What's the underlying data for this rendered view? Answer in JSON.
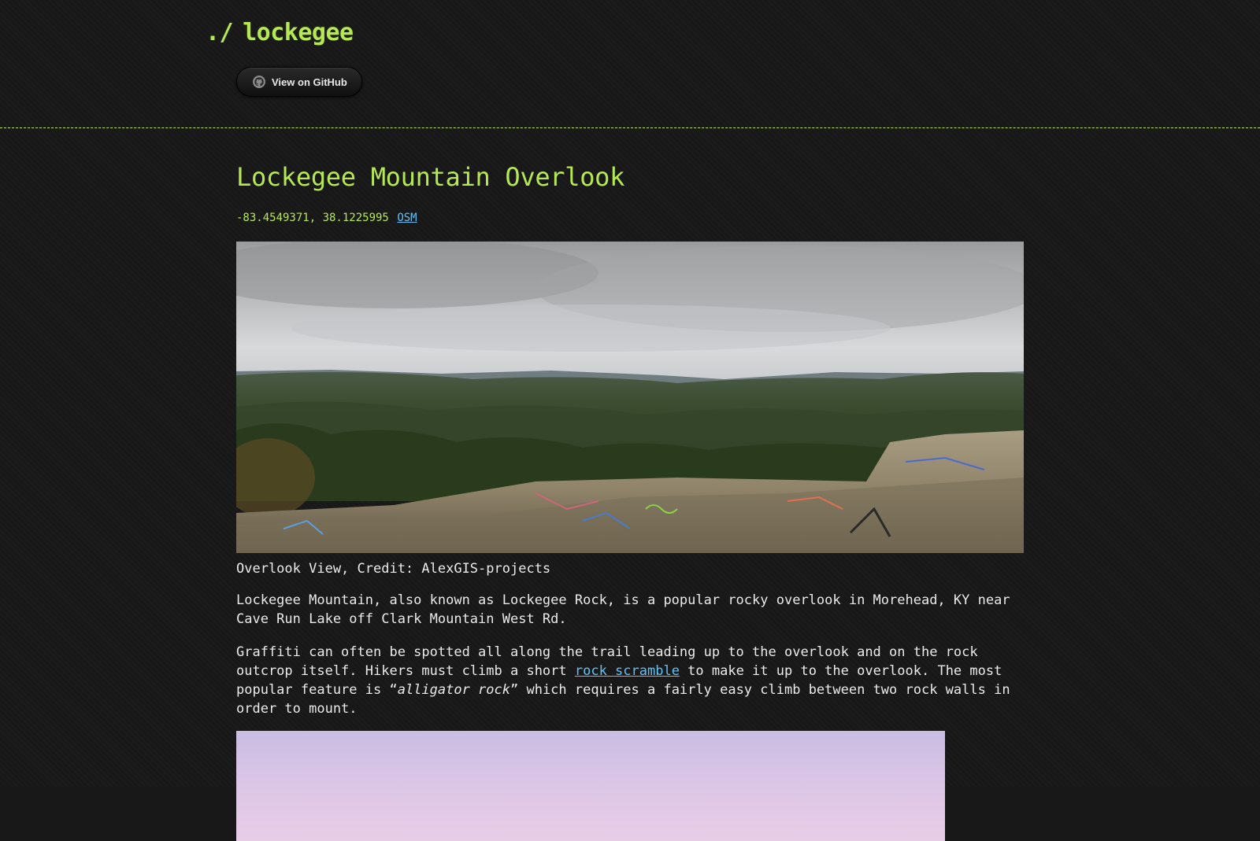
{
  "header": {
    "prompt": "./",
    "site_name": "lockegee",
    "github_button": "View on GitHub",
    "accent_color": "#b5e853"
  },
  "page": {
    "title": "Lockegee Mountain Overlook",
    "coordinates": "-83.4549371, 38.1225995",
    "osm_link": "OSM",
    "image_caption": "Overlook View, Credit: AlexGIS-projects",
    "paragraph1": "Lockegee Mountain, also known as Lockegee Rock, is a popular rocky overlook in Morehead, KY near Cave Run Lake off Clark Mountain West Rd.",
    "paragraph2_part1": "Graffiti can often be spotted all along the trail leading up to the overlook and on the rock outcrop itself. Hikers must climb a short ",
    "paragraph2_link": "rock scramble",
    "paragraph2_part2": " to make it up to the overlook. The most popular feature is “",
    "paragraph2_em": "alligator rock",
    "paragraph2_part3": "” which requires a fairly easy climb between two rock walls in order to mount.",
    "link_color": "#63c0f5"
  }
}
